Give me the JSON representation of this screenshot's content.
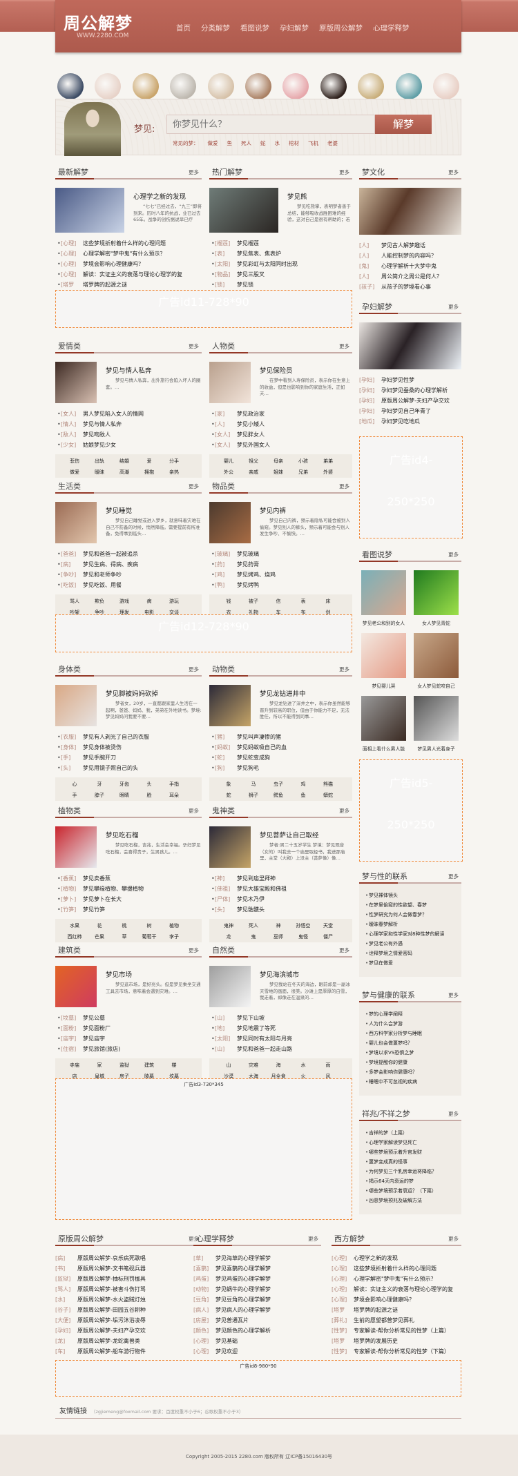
{
  "header": {
    "logo": "周公解梦",
    "logo_url": "WWW.2280.COM",
    "nav": [
      "首页",
      "分类解梦",
      "看图说梦",
      "孕妇解梦",
      "原版周公解梦",
      "心理学释梦"
    ]
  },
  "categories": [
    "人物类",
    "爱情类",
    "生活类",
    "物品类",
    "身体类",
    "动物类",
    "植物类",
    "鬼神类",
    "建筑类",
    "自然类",
    "梦文化"
  ],
  "search": {
    "label": "梦见:",
    "placeholder": "你梦见什么？",
    "button": "解梦",
    "hot_label": "常见的梦：",
    "hot": [
      "做爱",
      "鱼",
      "死人",
      "蛇",
      "水",
      "棺材",
      "飞机",
      "老婆"
    ]
  },
  "more": "更多",
  "latest": {
    "title": "最新解梦",
    "feature": {
      "title": "心理学之新的发现",
      "desc": "“七七”已经过去，“九三”即将到来。历时八年的抗战，业已过去65年。战争的创伤据说早已疗愈，而历…"
    },
    "items": [
      {
        "tag": "[心理]",
        "text": "这些梦境折射着什么样的心理问题"
      },
      {
        "tag": "[心理]",
        "text": "心理学解密\"梦中鬼\"有什么预示？"
      },
      {
        "tag": "[心理]",
        "text": "梦境会影响心理健康吗？"
      },
      {
        "tag": "[心理]",
        "text": "解读：实证主义的衰落与理论心理学的复"
      },
      {
        "tag": "[塔罗",
        "text": "塔罗牌的起源之谜"
      }
    ]
  },
  "hot": {
    "title": "热门解梦",
    "feature": {
      "title": "梦见熊",
      "desc": "梦见吃熊掌，表明梦者善于总结，能够吸收战胜困难的经验，这对自己是很有帮助的；若梦见将熊杀死，预示梦者会…"
    },
    "items": [
      {
        "tag": "[榴莲]",
        "text": "梦见榴莲"
      },
      {
        "tag": "[表]",
        "text": "梦见焦表、焦表炉"
      },
      {
        "tag": "[太阳]",
        "text": "梦见彩虹与太阳同时出现"
      },
      {
        "tag": "[物品]",
        "text": "梦见三股叉"
      },
      {
        "tag": "[锁]",
        "text": "梦见锁"
      }
    ]
  },
  "ads": {
    "a11": "广告id11-728*90",
    "a12": "广告id12-728*90",
    "a4": [
      "广告id4-",
      "250*250"
    ],
    "a5": [
      "广告id5-",
      "250*250"
    ],
    "a3": "广告id3-730*345",
    "a8": "广告id8-980*90"
  },
  "sections": [
    {
      "title": "爱情类",
      "feature": {
        "title": "梦见与情人私奔",
        "desc": "梦见与情人私奔，出外旅行会陷入坏人的圈套。…"
      },
      "items": [
        {
          "tag": "[女人]",
          "text": "男人梦见陷入女人的情网"
        },
        {
          "tag": "[情人]",
          "text": "梦见与情人私奔"
        },
        {
          "tag": "[敌人]",
          "text": "梦见吻敌人"
        },
        {
          "tag": "[少女]",
          "text": "姑娘梦见少女"
        }
      ],
      "tags": [
        "悲伤",
        "出轨",
        "结婚",
        "爱",
        "分手",
        "做爱",
        "暧昧",
        "高潮",
        "拥抱",
        "亲热"
      ]
    },
    {
      "title": "人物类",
      "feature": {
        "title": "梦见保险员",
        "desc": "在梦中看到人寿保险员，表示你在生意上的收益，但是也影响到你的家庭生活，正如天…"
      },
      "items": [
        {
          "tag": "[家]",
          "text": "梦见政治家"
        },
        {
          "tag": "[人]",
          "text": "梦见小矮人"
        },
        {
          "tag": "[女人]",
          "text": "梦见胖女人"
        },
        {
          "tag": "[女人]",
          "text": "梦见外国女人"
        }
      ],
      "tags": [
        "婴儿",
        "祖父",
        "母亲",
        "小孩",
        "弟弟",
        "外公",
        "亲戚",
        "姐妹",
        "兄弟",
        "外婆"
      ]
    },
    {
      "title": "生活类",
      "feature": {
        "title": "梦见睡觉",
        "desc": "梦见自己睡觉或进入梦乡，就意味着灾难在自己不防备的时候，悄然降临。需要提前有所准备，免得事到临头…"
      },
      "items": [
        {
          "tag": "[爸爸]",
          "text": "梦见和爸爸一起被追杀"
        },
        {
          "tag": "[病]",
          "text": "梦见生病、得病、疾病"
        },
        {
          "tag": "[争吵]",
          "text": "梦见和老师争吵"
        },
        {
          "tag": "[吃饭]",
          "text": "梦见吃饭、用餐"
        }
      ],
      "tags": [
        "骂人",
        "欺负",
        "游戏",
        "病",
        "游玩",
        "吵架",
        "争吵",
        "理发",
        "电影",
        "交谈"
      ]
    },
    {
      "title": "物品类",
      "feature": {
        "title": "梦见内裤",
        "desc": "梦见自己内裤，预示着隐私可能会被别人偷窥。梦见别人的裤头，预示着可能会与别人发生争吵、不愉快。…"
      },
      "items": [
        {
          "tag": "[玻璃]",
          "text": "梦见玻璃"
        },
        {
          "tag": "[药]",
          "text": "梦见药膏"
        },
        {
          "tag": "[鸡]",
          "text": "梦见烤鸡、烧鸡"
        },
        {
          "tag": "[鸭]",
          "text": "梦见烤鸭"
        }
      ],
      "tags": [
        "钱",
        "被子",
        "信",
        "表",
        "床",
        "衣",
        "礼物",
        "车",
        "布",
        "剑"
      ]
    },
    {
      "title": "身体类",
      "feature": {
        "title": "梦见脚被妈妈砍掉",
        "desc": "梦者女，20岁，一直都跟家里人生活在一起啊，爸爸、妈妈、我，弟弟在外地读书。梦境:梦见妈妈问我要不要…"
      },
      "items": [
        {
          "tag": "[衣服]",
          "text": "梦见有人剥光了自己的衣服"
        },
        {
          "tag": "[身体]",
          "text": "梦见身体被烫伤"
        },
        {
          "tag": "[手]",
          "text": "梦见手腕开刀"
        },
        {
          "tag": "[头]",
          "text": "梦见用镜子照自己的头"
        }
      ],
      "tags": [
        "心",
        "牙",
        "牙齿",
        "头",
        "手指",
        "手",
        "脖子",
        "眼睛",
        "脸",
        "耳朵"
      ]
    },
    {
      "title": "动物类",
      "feature": {
        "title": "梦见龙钻进井中",
        "desc": "梦见龙钻进了深井之中，表示你虽然能够晋升到较高的职位，但由于你能力不足，无法胜任，所以不能得到同事…"
      },
      "items": [
        {
          "tag": "[猪]",
          "text": "梦见叫声凄惨的猪"
        },
        {
          "tag": "[蚂蚁]",
          "text": "梦见蚂蚁吸自己的血"
        },
        {
          "tag": "[蛇]",
          "text": "梦见蛇变成狗"
        },
        {
          "tag": "[狗]",
          "text": "梦见狗毛"
        }
      ],
      "tags": [
        "象",
        "马",
        "虫子",
        "鸡",
        "熊猫",
        "蛇",
        "狮子",
        "鳄鱼",
        "鱼",
        "蟒蛇"
      ]
    },
    {
      "title": "植物类",
      "feature": {
        "title": "梦见吃石榴",
        "desc": "梦见吃石榴，吉兆，生活会幸福。孕妇梦见吃石榴，会喜得贵子，生男孩儿。…"
      },
      "items": [
        {
          "tag": "[香蕉]",
          "text": "梦见卖香蕉"
        },
        {
          "tag": "[植物]",
          "text": "梦见攀缘植物、攀援植物"
        },
        {
          "tag": "[萝卜]",
          "text": "梦见萝卜在长大"
        },
        {
          "tag": "[竹笋]",
          "text": "梦见竹笋"
        }
      ],
      "tags": [
        "水果",
        "花",
        "桃",
        "树",
        "植物",
        "西红柿",
        "芒果",
        "草",
        "葡萄干",
        "李子"
      ]
    },
    {
      "title": "鬼神类",
      "feature": {
        "title": "梦见菩萨让自己取经",
        "desc": "梦者:男二十五岁学生 梦境：梦见观音（女的）叫我去一个庙里取经书，我进那庙里，主堂（大殿）上没主（菩萨像）像…"
      },
      "items": [
        {
          "tag": "[神]",
          "text": "梦见到庙里拜神"
        },
        {
          "tag": "[佛祖]",
          "text": "梦见大雄宝殿和佛祖"
        },
        {
          "tag": "[尸体]",
          "text": "梦见木乃伊"
        },
        {
          "tag": "[头]",
          "text": "梦见骷髅头"
        }
      ],
      "tags": [
        "鬼神",
        "死人",
        "神",
        "孙悟空",
        "天堂",
        "龙",
        "鬼",
        "巫师",
        "鬼怪",
        "僵尸"
      ]
    },
    {
      "title": "建筑类",
      "feature": {
        "title": "梦见市场",
        "desc": "梦见逛市场，是好兆头。但是梦见乘坐交通工具去市场，意味着会遇到灾难。…"
      },
      "items": [
        {
          "tag": "[坟墓]",
          "text": "梦见公墓"
        },
        {
          "tag": "[面粉]",
          "text": "梦见面粉厂"
        },
        {
          "tag": "[庙宇]",
          "text": "梦见庙宇"
        },
        {
          "tag": "[住宿]",
          "text": "梦见旅馆(旅店)"
        }
      ],
      "tags": [
        "寺庙",
        "家",
        "监狱",
        "建筑",
        "楼",
        "店",
        "皇城",
        "房子",
        "陵墓",
        "坟墓"
      ]
    },
    {
      "title": "自然类",
      "feature": {
        "title": "梦见海滨城市",
        "desc": "梦见我站在冬天的海边，眼前却是一副冰天雪地的画面，很美。沙滩上是厚厚的白雪，我走着，却像走在温泉的…"
      },
      "items": [
        {
          "tag": "[山]",
          "text": "梦见下山坡"
        },
        {
          "tag": "[地]",
          "text": "梦见地震了等死"
        },
        {
          "tag": "[太阳]",
          "text": "梦见同时有太阳与月亮"
        },
        {
          "tag": "[山]",
          "text": "梦见和爸爸一起走山路"
        }
      ],
      "tags": [
        "山",
        "灾难",
        "海",
        "水",
        "雨",
        "沙漠",
        "大海",
        "月全食",
        "火",
        "风"
      ]
    }
  ],
  "culture": {
    "title": "梦文化",
    "items": [
      {
        "tag": "[人]",
        "text": "梦见古人解梦趣话"
      },
      {
        "tag": "[人]",
        "text": "人能控制梦的内容吗？"
      },
      {
        "tag": "[鬼]",
        "text": "心理学解析十大梦中鬼"
      },
      {
        "tag": "[人]",
        "text": "周公简介之周公是何人？"
      },
      {
        "tag": "[孩子]",
        "text": "从孩子的梦境看心事"
      }
    ]
  },
  "pregnant": {
    "title": "孕妇解梦",
    "items": [
      {
        "tag": "[孕妇]",
        "text": "孕妇梦见性梦"
      },
      {
        "tag": "[孕妇]",
        "text": "孕妇梦见蚕桑的心理学解析"
      },
      {
        "tag": "[孕妇]",
        "text": "原版周公解梦-夫妇产孕交欢"
      },
      {
        "tag": "[孕妇]",
        "text": "孕妇梦见自己年青了"
      },
      {
        "tag": "[地瓜]",
        "text": "孕妇梦见吃地瓜"
      }
    ]
  },
  "pictures": {
    "title": "看图说梦",
    "items": [
      "梦见老公和别的女人",
      "女人梦见青蛇",
      "梦见婴儿哭",
      "女人梦见蛇咬自己",
      "面相上看什么男人能",
      "梦见男人光着身子"
    ]
  },
  "sex": {
    "title": "梦与性的联系",
    "items": [
      "梦见裸体镜头",
      "在梦里偷窥的性欲望、春梦",
      "性梦研究为何人会做春梦？",
      "暧昧春梦解析",
      "心理学家和性学家对8种性梦的解读",
      "梦见老公有外遇",
      "诠释梦境之情爱密码",
      "梦见在做爱"
    ]
  },
  "health": {
    "title": "梦与健康的联系",
    "items": [
      "梦的心理学阐释",
      "人为什么会梦游",
      "西方科学家分析梦与睡眠",
      "婴儿也会做噩梦吗？",
      "梦境以求VS恐惧之梦",
      "梦境提醒你的健康",
      "多梦会影响你健康吗？",
      "睡眠中不可忽视的疾病"
    ]
  },
  "omen": {
    "title": "祥兆/不祥之梦",
    "items": [
      "吉祥的梦（上篇）",
      "心理学家解读梦见死亡",
      "哪些梦境预示着升官发财",
      "噩梦变成真的怪事",
      "为何梦见三个乳房幸运将降临？",
      "揭示64天内衰运的梦",
      "哪些梦境预示着衰运？（下篇）",
      "凶恶梦境预兆及破解方法"
    ]
  },
  "original": {
    "title": "原版周公解梦",
    "items": [
      {
        "tag": "[病]",
        "text": "原版周公解梦-哀乐病死歌唱"
      },
      {
        "tag": "[书]",
        "text": "原版周公解梦-文书笔砚兵器"
      },
      {
        "tag": "[监狱]",
        "text": "原版周公解梦-抽标刑罚枷具"
      },
      {
        "tag": "[骂人]",
        "text": "原版周公解梦-被害斗伤打骂"
      },
      {
        "tag": "[水]",
        "text": "原版周公解梦-水火盗贼灯烛"
      },
      {
        "tag": "[谷子]",
        "text": "原版周公解梦-田园五谷耕种"
      },
      {
        "tag": "[大便]",
        "text": "原版周公解梦-垢污沐浴凌辱"
      },
      {
        "tag": "[孕妇]",
        "text": "原版周公解梦-夫妇产孕交欢"
      },
      {
        "tag": "[龙]",
        "text": "原版周公解梦-龙蛇禽兽类"
      },
      {
        "tag": "[车]",
        "text": "原版周公解梦-船车游行物件"
      }
    ]
  },
  "psych": {
    "title": "心理学释梦",
    "items": [
      {
        "tag": "[草]",
        "text": "梦见海草的心理学解梦"
      },
      {
        "tag": "[喜鹊]",
        "text": "梦见喜鹊的心理学解梦"
      },
      {
        "tag": "[鸡蛋]",
        "text": "梦见鸡蛋的心理学解梦"
      },
      {
        "tag": "[动物]",
        "text": "梦见蜗牛的心理学解梦"
      },
      {
        "tag": "[豆角]",
        "text": "梦见豆角的心理学解梦"
      },
      {
        "tag": "[病人]",
        "text": "梦见病人的心理学解梦"
      },
      {
        "tag": "[房屋]",
        "text": "梦见普通瓦片"
      },
      {
        "tag": "[颜色]",
        "text": "梦见颜色的心理学解析"
      },
      {
        "tag": "[心理]",
        "text": "梦见基础"
      },
      {
        "tag": "[心理]",
        "text": "梦见欢迎"
      }
    ]
  },
  "western": {
    "title": "西方解梦",
    "items": [
      {
        "tag": "[心理]",
        "text": "心理学之新的发现"
      },
      {
        "tag": "[心理]",
        "text": "这些梦境折射着什么样的心理问题"
      },
      {
        "tag": "[心理]",
        "text": "心理学解密\"梦中鬼\"有什么预示？"
      },
      {
        "tag": "[心理]",
        "text": "解读：实证主义的衰落与理论心理学的复"
      },
      {
        "tag": "[心理]",
        "text": "梦境会影响心理健康吗？"
      },
      {
        "tag": "[塔罗",
        "text": "塔罗牌的起源之谜"
      },
      {
        "tag": "[葬礼]",
        "text": "生前的愿望都曾梦见葬礼"
      },
      {
        "tag": "[性梦]",
        "text": "专家解读-帮你分析常见的性梦（上篇）"
      },
      {
        "tag": "[塔罗",
        "text": "塔罗牌的发展历史"
      },
      {
        "tag": "[性梦]",
        "text": "专家解读-帮你分析常见的性梦（下篇）"
      }
    ]
  },
  "links": {
    "title": "友情链接",
    "note": "（zgjiemeng@foxmail.com 要求：百度权重不小于6；谷歌权重不小于3）"
  },
  "footer": "Copyright 2005-2015 2280.com 版权所有 辽ICP备15016430号"
}
